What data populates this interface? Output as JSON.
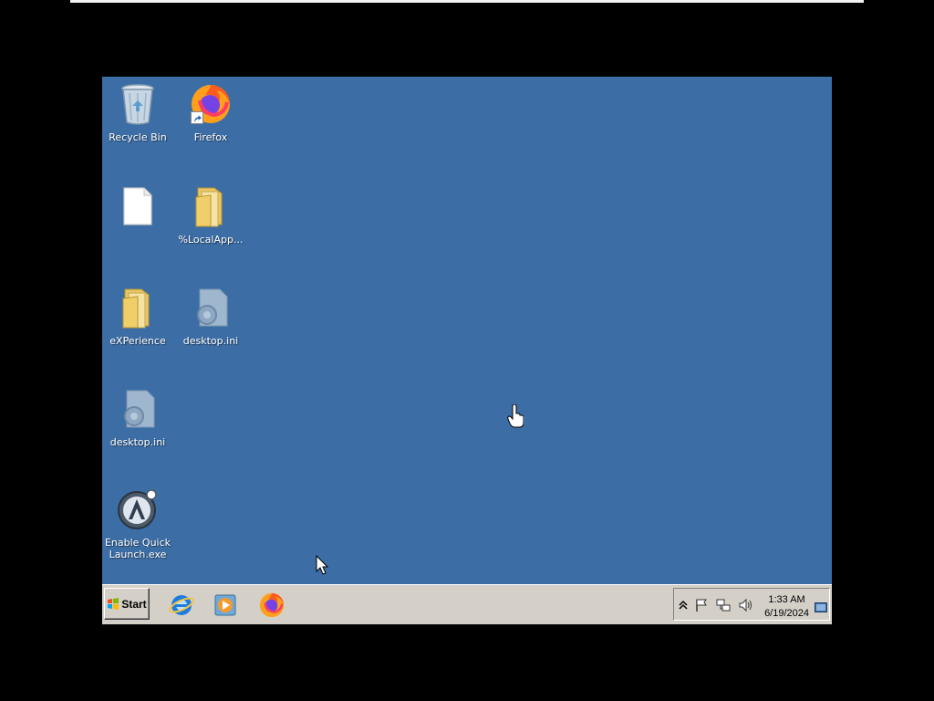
{
  "desktop": {
    "background_color": "#3c6ea5",
    "icons": [
      {
        "label": "Recycle Bin",
        "icon": "recycle-bin-icon"
      },
      {
        "label": "Firefox",
        "icon": "firefox-icon"
      },
      {
        "label": "",
        "icon": "blank-file-icon"
      },
      {
        "label": "%LocalApp...",
        "icon": "folder-icon"
      },
      {
        "label": "eXPerience",
        "icon": "folder-icon"
      },
      {
        "label": "desktop.ini",
        "icon": "settings-file-icon"
      },
      {
        "label": "desktop.ini",
        "icon": "settings-file-icon"
      },
      {
        "label": "Enable Quick\nLaunch.exe",
        "icon": "app-launcher-icon"
      }
    ]
  },
  "taskbar": {
    "start_label": "Start",
    "quick_launch": [
      {
        "icon": "internet-explorer-icon"
      },
      {
        "icon": "media-player-icon"
      },
      {
        "icon": "firefox-icon"
      }
    ],
    "tray": {
      "icons": [
        "show-hidden-icons-icon",
        "action-center-flag-icon",
        "network-icon",
        "volume-icon"
      ],
      "time": "1:33 AM",
      "date": "6/19/2024"
    }
  }
}
